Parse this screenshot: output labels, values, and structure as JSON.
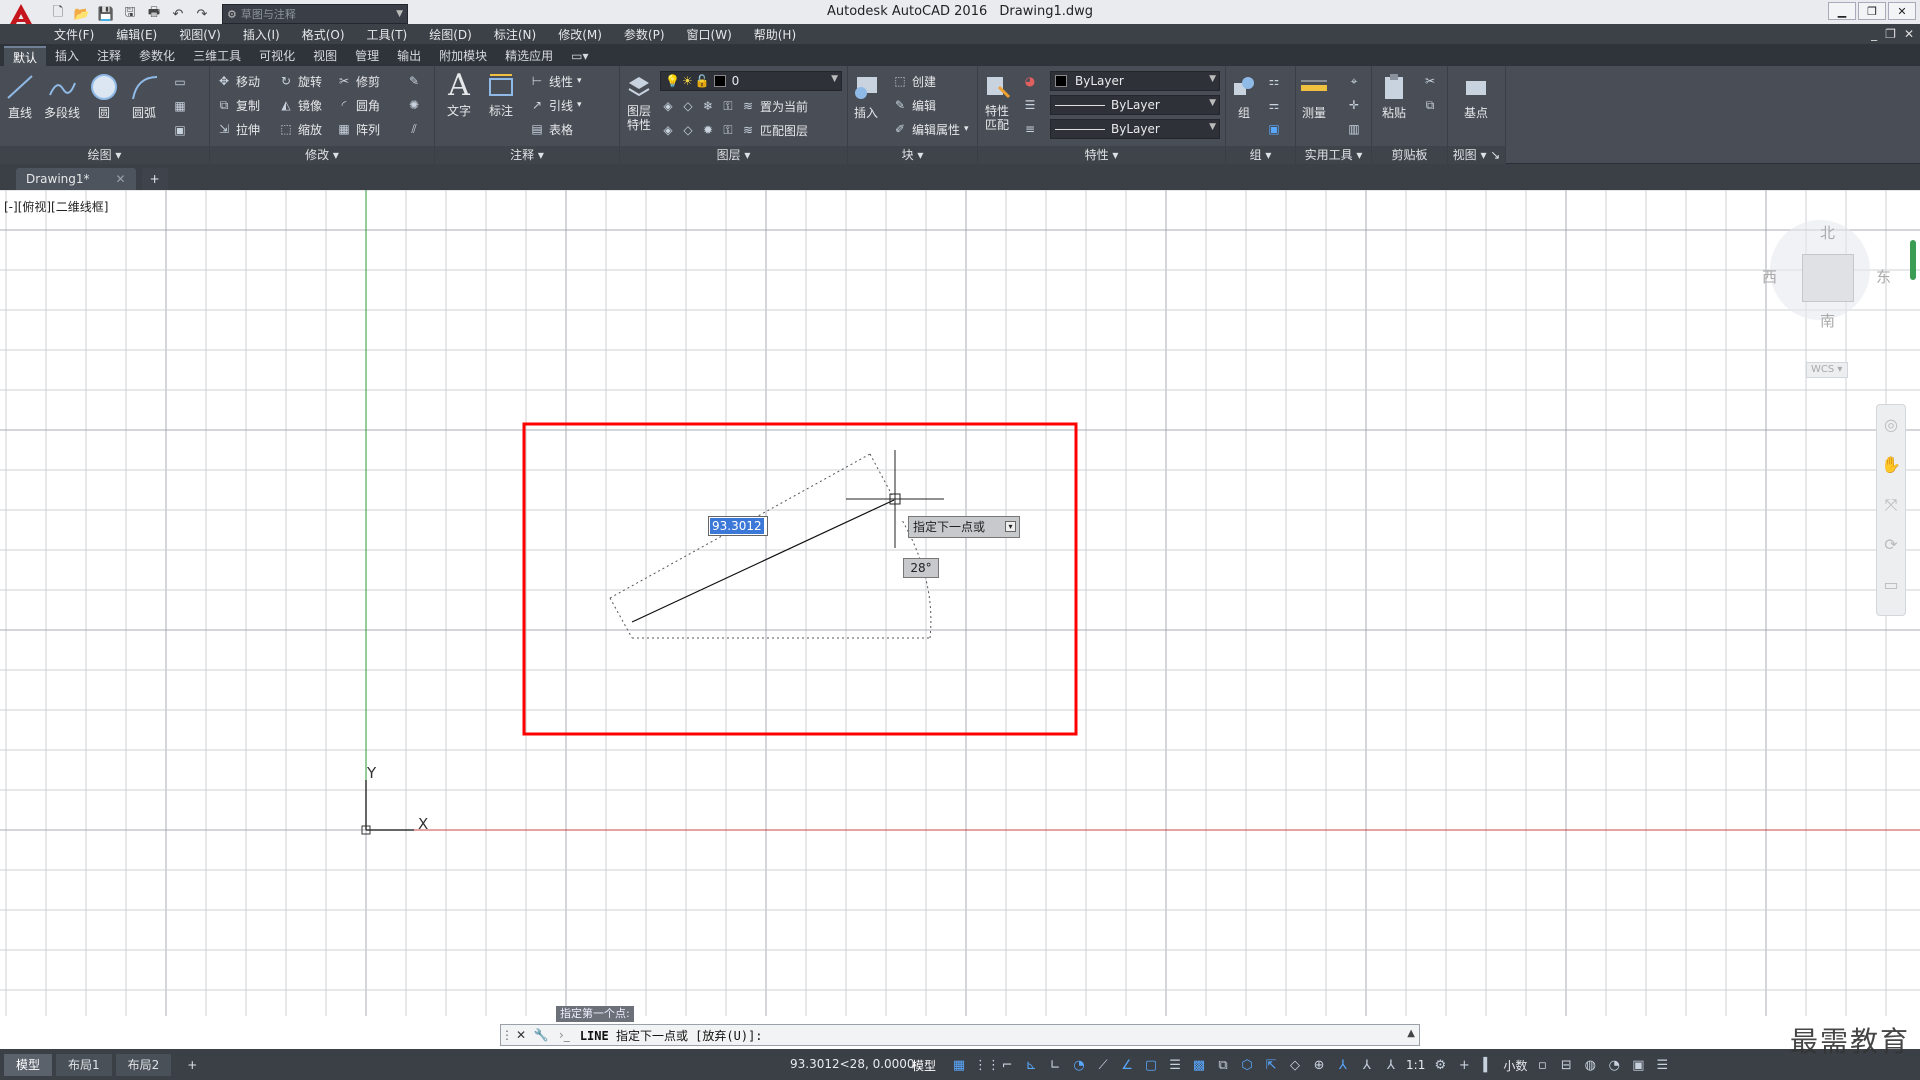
{
  "app": {
    "title": "Autodesk AutoCAD 2016",
    "document": "Drawing1.dwg",
    "workspace": "草图与注释"
  },
  "menus": [
    "文件(F)",
    "编辑(E)",
    "视图(V)",
    "插入(I)",
    "格式(O)",
    "工具(T)",
    "绘图(D)",
    "标注(N)",
    "修改(M)",
    "参数(P)",
    "窗口(W)",
    "帮助(H)"
  ],
  "ribbon_tabs": [
    "默认",
    "插入",
    "注释",
    "参数化",
    "三维工具",
    "可视化",
    "视图",
    "管理",
    "输出",
    "附加模块",
    "精选应用"
  ],
  "panels": {
    "draw": {
      "title": "绘图",
      "line": "直线",
      "polyline": "多段线",
      "circle": "圆",
      "arc": "圆弧"
    },
    "modify": {
      "title": "修改",
      "move": "移动",
      "rotate": "旋转",
      "trim": "修剪",
      "copy": "复制",
      "mirror": "镜像",
      "fillet": "圆角",
      "stretch": "拉伸",
      "scale": "缩放",
      "array": "阵列"
    },
    "annotation": {
      "title": "注释",
      "text": "文字",
      "dimension": "标注",
      "linear": "线性",
      "leader": "引线",
      "table": "表格"
    },
    "layers": {
      "title": "图层",
      "properties": "图层特性",
      "current_layer": "0",
      "set_current": "置为当前",
      "match_layer": "匹配图层"
    },
    "block": {
      "title": "块",
      "insert": "插入",
      "create": "创建",
      "edit": "编辑",
      "edit_attr": "编辑属性"
    },
    "properties": {
      "title": "特性",
      "match": "特性匹配",
      "color": "ByLayer",
      "linetype": "ByLayer",
      "lineweight": "ByLayer"
    },
    "groups": {
      "title": "组",
      "group": "组"
    },
    "utilities": {
      "title": "实用工具",
      "measure": "测量"
    },
    "clipboard": {
      "title": "剪贴板",
      "paste": "粘贴"
    },
    "view": {
      "title": "视图",
      "base": "基点"
    }
  },
  "file_tab": "Drawing1*",
  "view_label": "[-][俯视][二维线框]",
  "viewcube": {
    "north": "北",
    "south": "南",
    "east": "东",
    "west": "西",
    "wcs": "WCS"
  },
  "ucs": {
    "x": "X",
    "y": "Y"
  },
  "dynamic_input": {
    "length": "93.3012",
    "prompt": "指定下一点或",
    "angle": "28°"
  },
  "drawing": {
    "start": [
      516,
      522
    ],
    "end": [
      730,
      410
    ]
  },
  "command": {
    "history": "指定第一个点:",
    "prompt_prefix": "LINE",
    "prompt": "指定下一点或 [放弃(U)]:"
  },
  "layout_tabs": [
    "模型",
    "布局1",
    "布局2"
  ],
  "status": {
    "coords": "93.3012<28, 0.0000",
    "model": "模型",
    "scale": "1:1",
    "units": "小数"
  },
  "watermark": "最需教育",
  "colors": {
    "highlight_box": "#ff0000",
    "y_axis": "#2d9a36",
    "x_axis": "#c84545",
    "selection": "#3b78d8"
  }
}
